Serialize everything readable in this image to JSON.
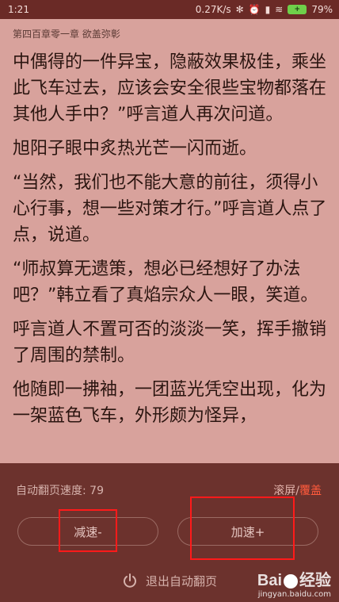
{
  "status_bar": {
    "time": "1:21",
    "network_speed": "0.27K/s",
    "battery": "79%",
    "battery_icon_text": "+"
  },
  "reader": {
    "chapter_title": "第四百章零一章 欲盖弥彰",
    "paragraphs": [
      "中偶得的一件异宝，隐蔽效果极佳，乘坐此飞车过去，应该会安全很些宝物都落在其他人手中？”呼言道人再次问道。",
      "旭阳子眼中炙热光芒一闪而逝。",
      "“当然，我们也不能大意的前往，须得小心行事，想一些对策才行。”呼言道人点了点，说道。",
      "“师叔算无遗策，想必已经想好了办法吧？”韩立看了真焰宗众人一眼，笑道。",
      "呼言道人不置可否的淡淡一笑，挥手撤销了周围的禁制。",
      "他随即一拂袖，一团蓝光凭空出现，化为一架蓝色飞车，外形颇为怪异，"
    ]
  },
  "auto_page_panel": {
    "speed_label": "自动翻页速度: 79",
    "mode_scroll": "滚屏",
    "mode_separator": "/",
    "mode_cover": "覆盖",
    "slow_button": "减速-",
    "fast_button": "加速+",
    "exit_button": "退出自动翻页"
  },
  "watermark": {
    "logo_left": "Bai",
    "logo_right": "经验",
    "url": "jingyan.baidu.com"
  },
  "colors": {
    "page_bg": "#d8a29c",
    "panel_bg": "#5c221e",
    "active_mode": "#ff5a3c",
    "highlight_box": "#ff1a1a"
  }
}
